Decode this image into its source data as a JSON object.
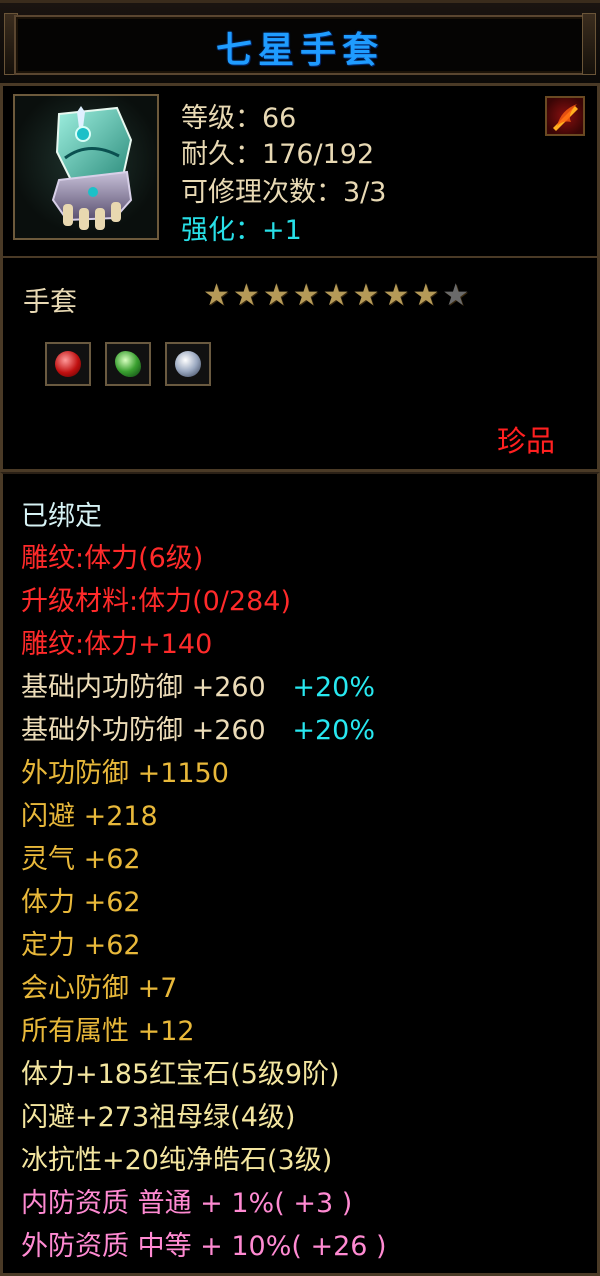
{
  "title": "七星手套",
  "stats": {
    "level": "等级：66",
    "durability": "耐久：176/192",
    "repairs": "可修理次数：3/3",
    "strengthen": "强化：+1"
  },
  "item_type": "手套",
  "stars": {
    "filled": 8,
    "total": 9
  },
  "gems": [
    "red-gem-icon",
    "green-gem-icon",
    "white-gem-icon"
  ],
  "rarity": "珍品",
  "attributes": {
    "bound": "已绑定",
    "engrave_name": "雕纹:体力(6级)",
    "upgrade_material": "升级材料:体力(0/284)",
    "engrave_value": "雕纹:体力+140",
    "base_inner_def": {
      "label": "基础内功防御  +260",
      "bonus": "+20%"
    },
    "base_outer_def": {
      "label": "基础外功防御  +260",
      "bonus": "+20%"
    },
    "outer_def": "外功防御  +1150",
    "dodge": "闪避  +218",
    "spirit": "灵气  +62",
    "stamina": "体力  +62",
    "focus": "定力  +62",
    "crit_def": "会心防御  +7",
    "all_attr": "所有属性  +12",
    "gem1": "体力+185红宝石(5级9阶)",
    "gem2": "闪避+273祖母绿(4级)",
    "gem3": "冰抗性+20纯净皓石(3级)",
    "inner_quality": "内防资质  普通  +  1%( +3 )",
    "outer_quality": "外防资质  中等  +  10%( +26 )"
  },
  "colors": {
    "title": "#1f9cff",
    "red": "#ff2a2a",
    "gold": "#e8b83a",
    "cyan": "#28e8f0",
    "pink": "#ff8ad2"
  }
}
